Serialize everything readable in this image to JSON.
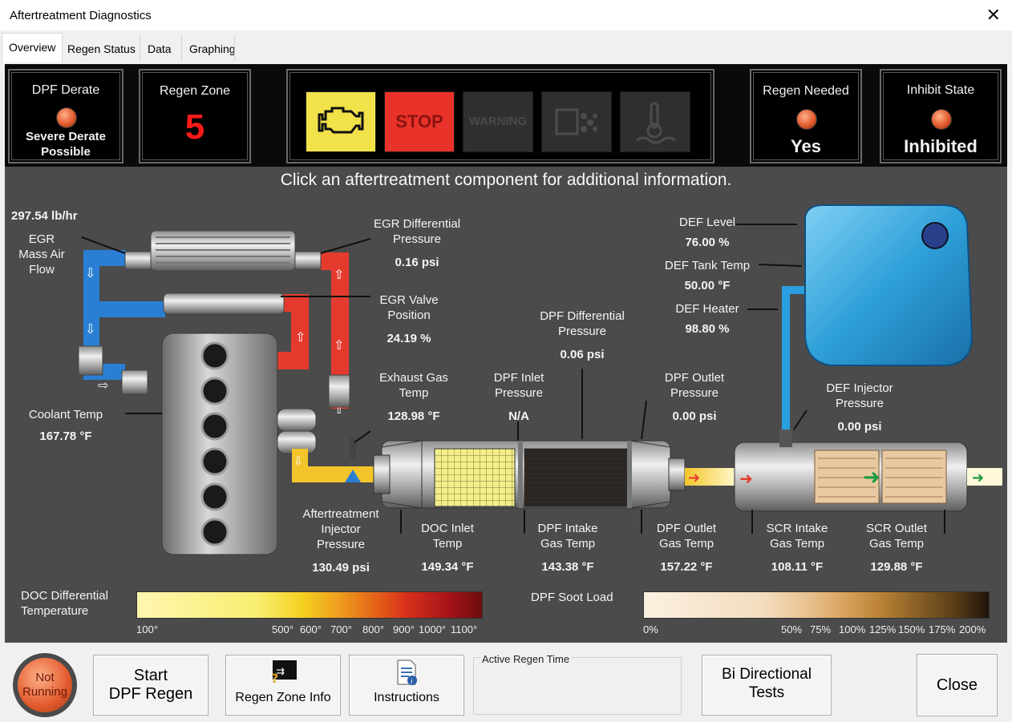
{
  "window": {
    "title": "Aftertreatment Diagnostics",
    "close_glyph": "✕"
  },
  "tabs": [
    {
      "label": "Overview"
    },
    {
      "label": "Regen Status"
    },
    {
      "label": "Data"
    },
    {
      "label": "Graphing"
    }
  ],
  "status": {
    "dpf_derate": {
      "label": "DPF Derate",
      "value_line1": "Severe Derate",
      "value_line2": "Possible"
    },
    "regen_zone": {
      "label": "Regen Zone",
      "value": "5"
    },
    "lamps": {
      "check_engine": "check-engine-icon",
      "stop": "STOP",
      "warning": "WARNING",
      "dpf": "dpf-icon",
      "temp": "high-exhaust-temp-icon"
    },
    "regen_needed": {
      "label": "Regen Needed",
      "value": "Yes"
    },
    "inhibit_state": {
      "label": "Inhibit State",
      "value": "Inhibited"
    }
  },
  "instruction": "Click an aftertreatment component for additional information.",
  "readings": {
    "egr_mass_air_flow": {
      "value": "297.54 lb/hr",
      "label1": "EGR",
      "label2": "Mass Air",
      "label3": "Flow"
    },
    "egr_diff_pressure": {
      "label1": "EGR Differential",
      "label2": "Pressure",
      "value": "0.16 psi"
    },
    "egr_valve_position": {
      "label1": "EGR Valve",
      "label2": "Position",
      "value": "24.19 %"
    },
    "coolant_temp": {
      "label": "Coolant Temp",
      "value": "167.78 °F"
    },
    "exhaust_gas_temp": {
      "label1": "Exhaust Gas",
      "label2": "Temp",
      "value": "128.98 °F"
    },
    "dpf_inlet_pressure": {
      "label1": "DPF Inlet",
      "label2": "Pressure",
      "value": "N/A"
    },
    "dpf_diff_pressure": {
      "label1": "DPF Differential",
      "label2": "Pressure",
      "value": "0.06 psi"
    },
    "dpf_outlet_pressure": {
      "label1": "DPF Outlet",
      "label2": "Pressure",
      "value": "0.00 psi"
    },
    "def_level": {
      "label": "DEF Level",
      "value": "76.00 %"
    },
    "def_tank_temp": {
      "label": "DEF Tank Temp",
      "value": "50.00 °F"
    },
    "def_heater": {
      "label": "DEF Heater",
      "value": "98.80 %"
    },
    "def_injector_pressure": {
      "label1": "DEF Injector",
      "label2": "Pressure",
      "value": "0.00 psi"
    },
    "at_injector_pressure": {
      "label1": "Aftertreatment",
      "label2": "Injector",
      "label3": "Pressure",
      "value": "130.49 psi"
    },
    "doc_inlet_temp": {
      "label1": "DOC Inlet",
      "label2": "Temp",
      "value": "149.34 °F"
    },
    "dpf_intake_gas_temp": {
      "label1": "DPF Intake",
      "label2": "Gas Temp",
      "value": "143.38 °F"
    },
    "dpf_outlet_gas_temp": {
      "label1": "DPF Outlet",
      "label2": "Gas Temp",
      "value": "157.22 °F"
    },
    "scr_intake_gas_temp": {
      "label1": "SCR Intake",
      "label2": "Gas Temp",
      "value": "108.11 °F"
    },
    "scr_outlet_gas_temp": {
      "label1": "SCR Outlet",
      "label2": "Gas Temp",
      "value": "129.88 °F"
    }
  },
  "scales": {
    "doc_diff": {
      "label1": "DOC Differential",
      "label2": "Temperature",
      "ticks": [
        "100°",
        "500°",
        "600°",
        "700°",
        "800°",
        "900°",
        "1000°",
        "1100°"
      ]
    },
    "soot": {
      "label": "DPF Soot Load",
      "ticks": [
        "0%",
        "50%",
        "75%",
        "100%",
        "125%",
        "150%",
        "175%",
        "200%"
      ]
    }
  },
  "buttons": {
    "not_running_line1": "Not",
    "not_running_line2": "Running",
    "start_regen_line1": "Start",
    "start_regen_line2": "DPF Regen",
    "regen_zone_info": "Regen Zone Info",
    "instructions": "Instructions",
    "active_regen_time_label": "Active Regen Time",
    "bi_directional_line1": "Bi Directional",
    "bi_directional_line2": "Tests",
    "close": "Close"
  },
  "colors": {
    "panel": "#4b4b4b",
    "accent_yellow": "#f4e650",
    "regen_zone_red": "#ff1a1a",
    "lamp_on_yellow": "#f2e24a",
    "lamp_stop_red": "#e8322a"
  }
}
